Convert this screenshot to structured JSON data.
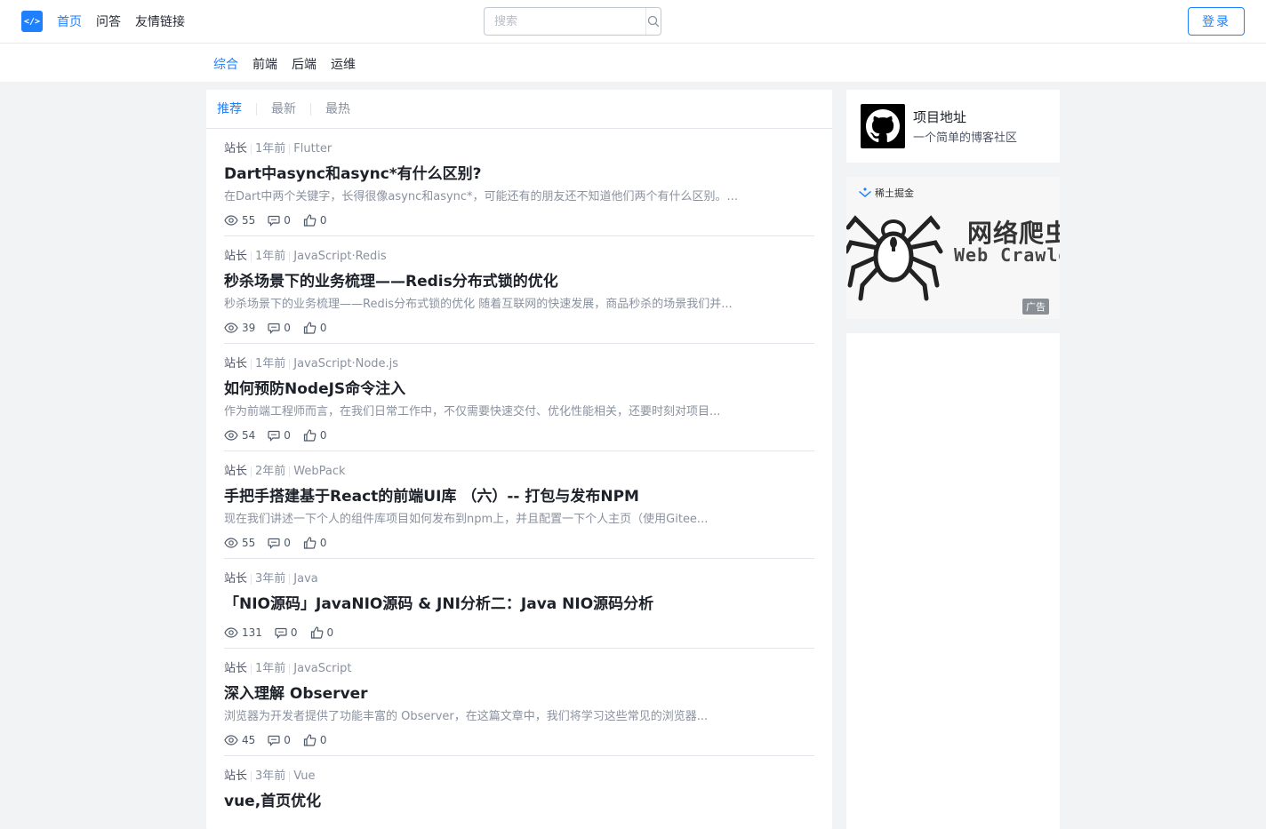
{
  "header": {
    "logo_text": "</>",
    "nav": [
      {
        "label": "首页",
        "active": true
      },
      {
        "label": "问答",
        "active": false
      },
      {
        "label": "友情链接",
        "active": false
      }
    ],
    "search": {
      "placeholder": "搜索",
      "value": ""
    },
    "login_label": "登录"
  },
  "subnav": [
    {
      "label": "综合",
      "active": true
    },
    {
      "label": "前端",
      "active": false
    },
    {
      "label": "后端",
      "active": false
    },
    {
      "label": "运维",
      "active": false
    }
  ],
  "feed": {
    "tabs": [
      {
        "label": "推荐",
        "active": true
      },
      {
        "label": "最新",
        "active": false
      },
      {
        "label": "最热",
        "active": false
      }
    ],
    "entries": [
      {
        "author": "站长",
        "time": "1年前",
        "tags": "Flutter",
        "title": "Dart中async和async*有什么区别?",
        "abstract": "在Dart中两个关键字，长得很像async和async*，可能还有的朋友还不知道他们两个有什么区别。...",
        "views": "55",
        "comments": "0",
        "likes": "0"
      },
      {
        "author": "站长",
        "time": "1年前",
        "tags": "JavaScript·Redis",
        "title": "秒杀场景下的业务梳理——Redis分布式锁的优化",
        "abstract": "秒杀场景下的业务梳理——Redis分布式锁的优化 随着互联网的快速发展，商品秒杀的场景我们并...",
        "views": "39",
        "comments": "0",
        "likes": "0"
      },
      {
        "author": "站长",
        "time": "1年前",
        "tags": "JavaScript·Node.js",
        "title": "如何预防NodeJS命令注入",
        "abstract": "作为前端工程师而言，在我们日常工作中，不仅需要快速交付、优化性能相关，还要时刻对项目...",
        "views": "54",
        "comments": "0",
        "likes": "0"
      },
      {
        "author": "站长",
        "time": "2年前",
        "tags": "WebPack",
        "title": "手把手搭建基于React的前端UI库 （六）-- 打包与发布NPM",
        "abstract": "现在我们讲述一下个人的组件库项目如何发布到npm上，并且配置一下个人主页（使用Gitee...",
        "views": "55",
        "comments": "0",
        "likes": "0"
      },
      {
        "author": "站长",
        "time": "3年前",
        "tags": "Java",
        "title": "「NIO源码」JavaNIO源码 & JNI分析二：Java NIO源码分析",
        "abstract": "",
        "views": "131",
        "comments": "0",
        "likes": "0"
      },
      {
        "author": "站长",
        "time": "1年前",
        "tags": "JavaScript",
        "title": "深入理解 Observer",
        "abstract": "浏览器为开发者提供了功能丰富的 Observer，在这篇文章中，我们将学习这些常见的浏览器...",
        "views": "45",
        "comments": "0",
        "likes": "0"
      },
      {
        "author": "站长",
        "time": "3年前",
        "tags": "Vue",
        "title": "vue,首页优化",
        "abstract": "",
        "views": "",
        "comments": "",
        "likes": ""
      }
    ]
  },
  "sidebar": {
    "project": {
      "title": "项目地址",
      "desc": "一个简单的博客社区"
    },
    "ad": {
      "brand": "稀土掘金",
      "title": "网络爬虫",
      "subtitle": "Web Crawler",
      "badge": "广告"
    }
  },
  "colors": {
    "accent": "#1e80ff",
    "text": "#1d2129",
    "muted": "#8a919f",
    "background": "#f2f3f5"
  }
}
